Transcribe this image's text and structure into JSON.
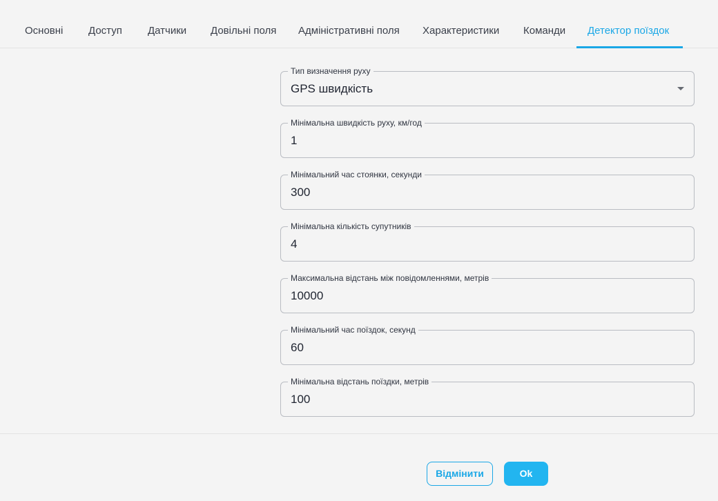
{
  "tabs": [
    {
      "label": "Основні"
    },
    {
      "label": "Доступ"
    },
    {
      "label": "Датчики"
    },
    {
      "label": "Довільні поля"
    },
    {
      "label": "Адміністративні поля"
    },
    {
      "label": "Характеристики"
    },
    {
      "label": "Команди"
    },
    {
      "label": "Детектор поїздок",
      "active": true
    }
  ],
  "colors": {
    "accent": "#1aa7e6",
    "ok_button": "#22b5f0",
    "background": "#f4f4f4"
  },
  "form": {
    "fields": [
      {
        "label": "Тип визначення руху",
        "value": "GPS швидкість",
        "type": "select"
      },
      {
        "label": "Мінімальна швидкість руху, км/год",
        "value": "1"
      },
      {
        "label": "Мінімальний час стоянки, секунди",
        "value": "300"
      },
      {
        "label": "Мінімальна кількість супутників",
        "value": "4"
      },
      {
        "label": "Максимальна відстань між повідомленнями, метрів",
        "value": "10000"
      },
      {
        "label": "Мінімальний час поїздок, секунд",
        "value": "60"
      },
      {
        "label": "Мінімальна відстань поїздки, метрів",
        "value": "100"
      }
    ]
  },
  "footer": {
    "cancel_label": "Відмінити",
    "ok_label": "Ok"
  }
}
